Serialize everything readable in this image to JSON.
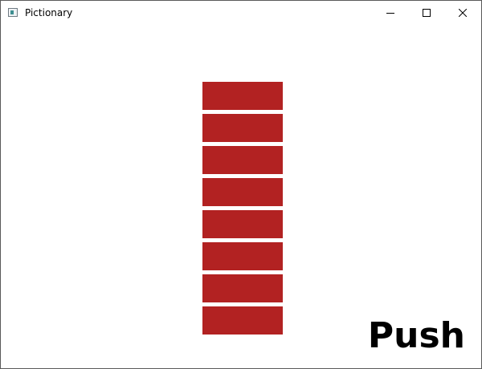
{
  "window": {
    "title": "Pictionary",
    "icon": "app-window-icon",
    "controls": [
      "minimize-icon",
      "maximize-icon",
      "close-icon"
    ]
  },
  "stack": {
    "block_count": 8,
    "block_color": "#b22222"
  },
  "push_label": "Push"
}
